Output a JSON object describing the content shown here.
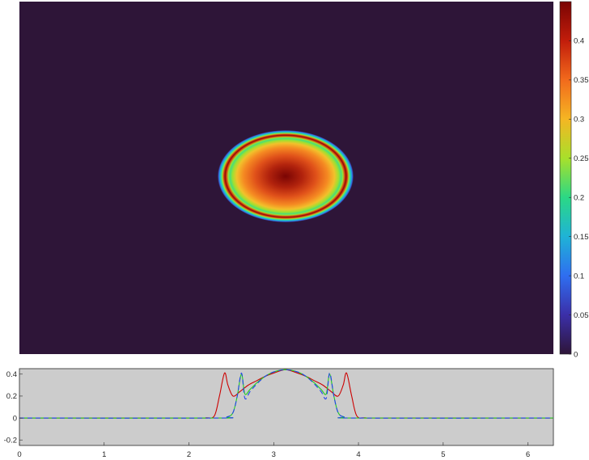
{
  "chart_data": [
    {
      "type": "heatmap",
      "title": "",
      "description_colormap": "jet",
      "background_color": "#2e1538",
      "colorbar": {
        "range": [
          0,
          0.45
        ],
        "ticks": [
          0,
          0.05,
          0.1,
          0.15,
          0.2,
          0.25,
          0.3,
          0.35,
          0.4
        ],
        "tick_labels": [
          "0",
          "0.05",
          "0.1",
          "0.15",
          "0.2",
          "0.25",
          "0.3",
          "0.35",
          "0.4"
        ],
        "colors": [
          "#2e1538",
          "#3b2fa8",
          "#2f6ef0",
          "#1fb3d6",
          "#2bd885",
          "#a8e02b",
          "#f5b623",
          "#f26a1c",
          "#c21d0b",
          "#7a0403"
        ]
      },
      "blob": {
        "peak_value": 0.44,
        "ring_value": 0.44,
        "center_x": 3.14,
        "description": "elliptical blob with bright ring near the edge"
      }
    },
    {
      "type": "line",
      "title": "",
      "xlabel": "",
      "ylabel": "",
      "xlim": [
        0,
        6.3
      ],
      "ylim": [
        -0.25,
        0.45
      ],
      "x_ticks": [
        0,
        1,
        2,
        3,
        4,
        5,
        6
      ],
      "x_tick_labels": [
        "0",
        "1",
        "2",
        "3",
        "4",
        "5",
        "6"
      ],
      "y_ticks": [
        -0.2,
        0,
        0.2,
        0.4
      ],
      "y_tick_labels": [
        "-0.2",
        "0",
        "0.2",
        "0.4"
      ],
      "background": "#cccccc",
      "series": [
        {
          "color": "#cc0000",
          "style": "solid",
          "x": [
            0,
            2.0,
            2.2,
            2.3,
            2.36,
            2.42,
            2.46,
            2.52,
            2.6,
            2.7,
            2.8,
            2.9,
            3.0,
            3.14,
            3.28,
            3.38,
            3.48,
            3.58,
            3.68,
            3.76,
            3.82,
            3.86,
            3.92,
            3.98,
            4.08,
            4.3,
            6.3
          ],
          "y": [
            0,
            0,
            0.002,
            0.02,
            0.2,
            0.41,
            0.3,
            0.2,
            0.24,
            0.3,
            0.34,
            0.38,
            0.41,
            0.44,
            0.41,
            0.38,
            0.34,
            0.3,
            0.24,
            0.2,
            0.3,
            0.41,
            0.2,
            0.02,
            0.002,
            0,
            0
          ]
        },
        {
          "color": "#22cc22",
          "style": "solid",
          "x": [
            0,
            2.3,
            2.45,
            2.52,
            2.57,
            2.62,
            2.66,
            2.72,
            2.8,
            2.9,
            3.0,
            3.14,
            3.28,
            3.38,
            3.48,
            3.56,
            3.62,
            3.66,
            3.71,
            3.76,
            3.83,
            3.98,
            6.3
          ],
          "y": [
            0,
            0,
            0.01,
            0.05,
            0.2,
            0.4,
            0.22,
            0.26,
            0.32,
            0.38,
            0.42,
            0.44,
            0.42,
            0.38,
            0.32,
            0.26,
            0.22,
            0.4,
            0.2,
            0.05,
            0.01,
            0,
            0
          ]
        },
        {
          "color": "#2244ee",
          "style": "dashed",
          "x": [
            0,
            2.3,
            2.45,
            2.52,
            2.57,
            2.62,
            2.66,
            2.72,
            2.8,
            2.9,
            3.0,
            3.14,
            3.28,
            3.38,
            3.48,
            3.56,
            3.62,
            3.66,
            3.71,
            3.76,
            3.83,
            3.98,
            6.3
          ],
          "y": [
            0,
            0,
            0.01,
            0.05,
            0.2,
            0.41,
            0.18,
            0.24,
            0.31,
            0.38,
            0.42,
            0.44,
            0.42,
            0.38,
            0.31,
            0.24,
            0.18,
            0.41,
            0.2,
            0.05,
            0.01,
            0,
            0
          ]
        }
      ]
    }
  ]
}
